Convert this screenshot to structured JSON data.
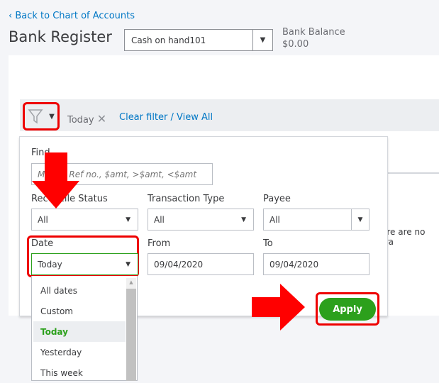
{
  "header": {
    "back_link": "Back to Chart of Accounts",
    "title": "Bank Register",
    "account": "Cash on hand101",
    "balance_label": "Bank Balance",
    "balance_value": "$0.00"
  },
  "filter_bar": {
    "chip": "Today",
    "clear": "Clear filter / View All"
  },
  "background_text": "ere are no tra",
  "filter": {
    "find_label": "Find",
    "find_placeholder": "Memo, Ref no., $amt, >$amt, <$amt",
    "reconcile_label": "Reconcile Status",
    "reconcile_value": "All",
    "type_label": "Transaction Type",
    "type_value": "All",
    "payee_label": "Payee",
    "payee_value": "All",
    "date_label": "Date",
    "date_value": "Today",
    "from_label": "From",
    "from_value": "09/04/2020",
    "to_label": "To",
    "to_value": "09/04/2020",
    "apply": "Apply",
    "date_options": [
      "All dates",
      "Custom",
      "Today",
      "Yesterday",
      "This week"
    ]
  },
  "colors": {
    "accent": "#2ca01c",
    "link": "#0077c5",
    "highlight": "#ee0000"
  }
}
